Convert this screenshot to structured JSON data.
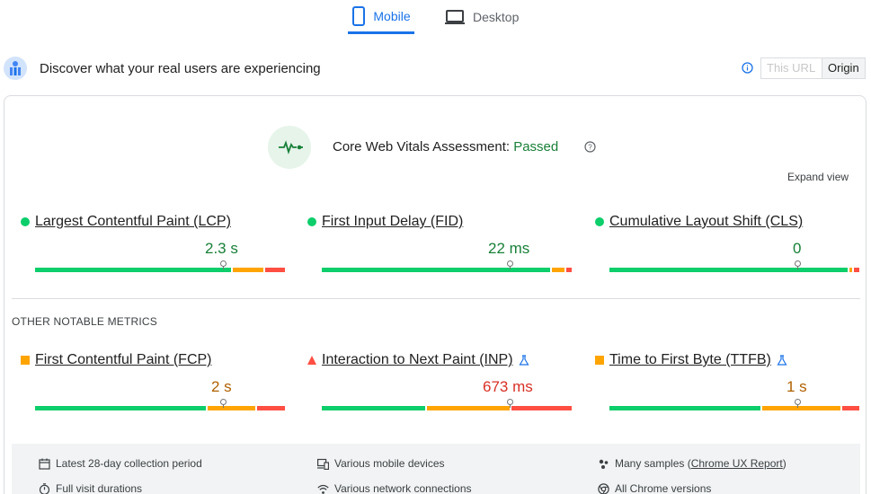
{
  "tabs": [
    {
      "label": "Mobile",
      "active": true,
      "icon": "smartphone-icon"
    },
    {
      "label": "Desktop",
      "active": false,
      "icon": "laptop-icon"
    }
  ],
  "header": {
    "title": "Discover what your real users are experiencing",
    "toggle": {
      "this_url": "This URL",
      "origin": "Origin",
      "selected": "Origin"
    }
  },
  "assessment": {
    "label": "Core Web Vitals Assessment: ",
    "status": "Passed",
    "expand": "Expand view"
  },
  "core_metrics": [
    {
      "label": "Largest Contentful Paint (LCP)",
      "value": "2.3 s",
      "rating": "good",
      "indicator": "circle",
      "distribution": {
        "good": 0.79,
        "needs_improvement": 0.13,
        "poor": 0.08
      },
      "marker": 0.75
    },
    {
      "label": "First Input Delay (FID)",
      "value": "22 ms",
      "rating": "good",
      "indicator": "circle",
      "distribution": {
        "good": 0.92,
        "needs_improvement": 0.06,
        "poor": 0.02
      },
      "marker": 0.75
    },
    {
      "label": "Cumulative Layout Shift (CLS)",
      "value": "0",
      "rating": "good",
      "indicator": "circle",
      "distribution": {
        "good": 0.96,
        "needs_improvement": 0.02,
        "poor": 0.02
      },
      "marker": 0.75
    }
  ],
  "notable_title": "OTHER NOTABLE METRICS",
  "notable_metrics": [
    {
      "label": "First Contentful Paint (FCP)",
      "value": "2 s",
      "rating": "avg",
      "indicator": "square",
      "experimental": false,
      "distribution": {
        "good": 0.69,
        "needs_improvement": 0.2,
        "poor": 0.11
      },
      "marker": 0.75
    },
    {
      "label": "Interaction to Next Paint (INP)",
      "value": "673 ms",
      "rating": "poor",
      "indicator": "triangle",
      "experimental": true,
      "distribution": {
        "good": 0.42,
        "needs_improvement": 0.34,
        "poor": 0.24
      },
      "marker": 0.75
    },
    {
      "label": "Time to First Byte (TTFB)",
      "value": "1 s",
      "rating": "avg",
      "indicator": "square",
      "experimental": true,
      "distribution": {
        "good": 0.61,
        "needs_improvement": 0.32,
        "poor": 0.07
      },
      "marker": 0.75
    }
  ],
  "footer": [
    {
      "icon": "calendar-icon",
      "text": "Latest 28-day collection period"
    },
    {
      "icon": "devices-icon",
      "text": "Various mobile devices"
    },
    {
      "icon": "people-icon",
      "text": "Many samples (",
      "link": "Chrome UX Report",
      "after": ")"
    },
    {
      "icon": "timer-icon",
      "text": "Full visit durations"
    },
    {
      "icon": "wifi-icon",
      "text": "Various network connections"
    },
    {
      "icon": "chrome-icon",
      "text": "All Chrome versions"
    }
  ],
  "colors": {
    "good": "#0cce6b",
    "needs_improvement": "#ffa400",
    "poor": "#ff4e42",
    "accent": "#1a73e8"
  }
}
